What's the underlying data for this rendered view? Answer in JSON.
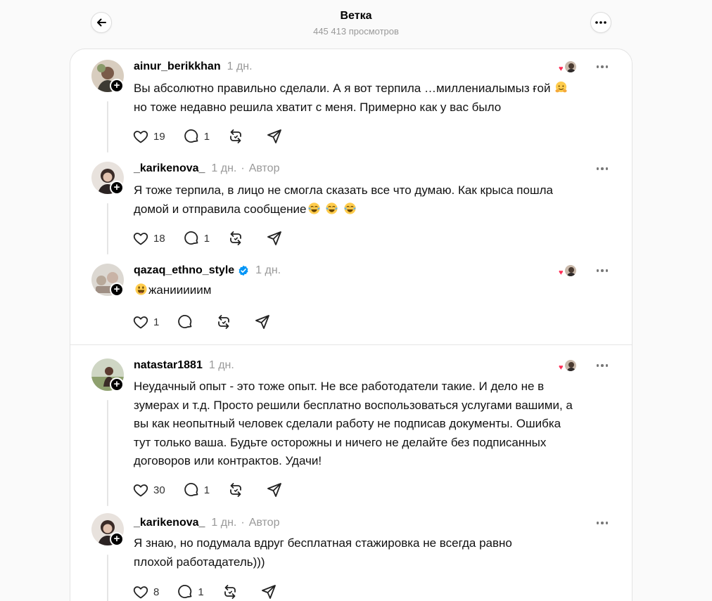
{
  "page": {
    "title": "Ветка",
    "views": "445 413 просмотров"
  },
  "posts": [
    {
      "username": "ainur_berikkhan",
      "time": "1 дн.",
      "author_label": "",
      "verified": false,
      "liked_by_author": true,
      "text_lines": [
        "Вы абсолютно правильно сделали. А я вот терпила …миллениалымыз ғой",
        "но тоже недавно решила хватит с меня. Примерно как у вас было"
      ],
      "likes": "19",
      "replies": "1"
    },
    {
      "username": "_karikenova_",
      "time": "1 дн.",
      "author_label": "Автор",
      "verified": false,
      "liked_by_author": false,
      "text_lines": [
        "Я тоже терпила, в лицо не смогла сказать все что думаю. Как крыса пошла",
        "домой и отправила сообщение"
      ],
      "likes": "18",
      "replies": "1"
    },
    {
      "username": "qazaq_ethno_style",
      "time": "1 дн.",
      "author_label": "",
      "verified": true,
      "liked_by_author": true,
      "text_lines": [
        "жанииииим"
      ],
      "likes": "1",
      "replies": ""
    },
    {
      "username": "natastar1881",
      "time": "1 дн.",
      "author_label": "",
      "verified": false,
      "liked_by_author": true,
      "text_lines": [
        "Неудачный опыт - это тоже опыт. Не все работодатели такие. И дело не в",
        "зумерах и т.д. Просто решили бесплатно воспользоваться услугами вашими, а",
        "вы как неопытный человек сделали работу не подписав документы. Ошибка",
        "тут только ваша. Будьте осторожны и ничего не делайте без подписанных",
        "договоров или контрактов. Удачи!"
      ],
      "likes": "30",
      "replies": "1"
    },
    {
      "username": "_karikenova_",
      "time": "1 дн.",
      "author_label": "Автор",
      "verified": false,
      "liked_by_author": false,
      "text_lines": [
        "Я знаю, но подумала вдруг бесплатная стажировка не всегда равно",
        "плохой работадатель)))"
      ],
      "likes": "8",
      "replies": "1"
    }
  ],
  "icons": {
    "back": "arrow-left-icon",
    "more": "more-horizontal-icon",
    "like": "heart-icon",
    "reply": "comment-icon",
    "repost": "repost-icon",
    "share": "send-icon",
    "verified": "verified-badge-icon"
  },
  "colors": {
    "verified": "#0095f6",
    "heart": "#ff2d55",
    "muted": "#999999"
  }
}
